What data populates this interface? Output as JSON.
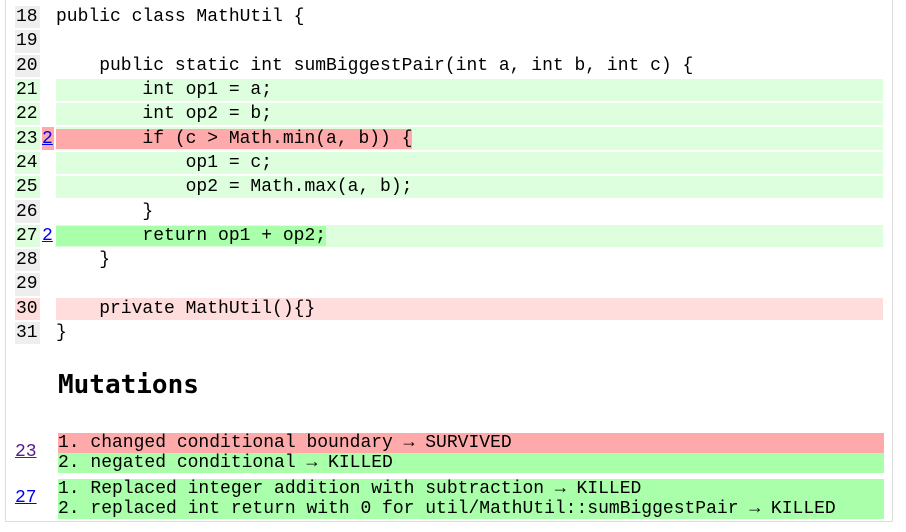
{
  "source": {
    "lines": [
      {
        "num": "18",
        "mutations": "",
        "text": "public class MathUtil {",
        "coverage": "none",
        "highlight": ""
      },
      {
        "num": "19",
        "mutations": "",
        "text": "",
        "coverage": "none",
        "highlight": ""
      },
      {
        "num": "20",
        "mutations": "",
        "text": "    public static int sumBiggestPair(int a, int b, int c) {",
        "coverage": "none",
        "highlight": ""
      },
      {
        "num": "21",
        "mutations": "",
        "text": "        int op1 = a;",
        "coverage": "covered",
        "highlight": ""
      },
      {
        "num": "22",
        "mutations": "",
        "text": "        int op2 = b;",
        "coverage": "covered",
        "highlight": ""
      },
      {
        "num": "23",
        "mutations": "2",
        "text": "        if (c > Math.min(a, b)) {",
        "coverage": "covered",
        "highlight": "survived"
      },
      {
        "num": "24",
        "mutations": "",
        "text": "            op1 = c;",
        "coverage": "covered",
        "highlight": ""
      },
      {
        "num": "25",
        "mutations": "",
        "text": "            op2 = Math.max(a, b);",
        "coverage": "covered",
        "highlight": ""
      },
      {
        "num": "26",
        "mutations": "",
        "text": "        }",
        "coverage": "none",
        "highlight": ""
      },
      {
        "num": "27",
        "mutations": "2",
        "text": "        return op1 + op2;",
        "coverage": "covered",
        "highlight": "killed"
      },
      {
        "num": "28",
        "mutations": "",
        "text": "    }",
        "coverage": "none",
        "highlight": ""
      },
      {
        "num": "29",
        "mutations": "",
        "text": "",
        "coverage": "none",
        "highlight": ""
      },
      {
        "num": "30",
        "mutations": "",
        "text": "    private MathUtil(){}",
        "coverage": "uncovered",
        "highlight": ""
      },
      {
        "num": "31",
        "mutations": "",
        "text": "}",
        "coverage": "none",
        "highlight": ""
      }
    ]
  },
  "mutations": {
    "heading": "Mutations",
    "groups": [
      {
        "line": "23",
        "visited": true,
        "items": [
          {
            "text": "1. changed conditional boundary → SURVIVED",
            "status": "SURVIVED"
          },
          {
            "text": "2. negated conditional → KILLED",
            "status": "KILLED"
          }
        ]
      },
      {
        "line": "27",
        "visited": false,
        "items": [
          {
            "text": "1. Replaced integer addition with subtraction → KILLED",
            "status": "KILLED"
          },
          {
            "text": "2. replaced int return with 0 for util/MathUtil::sumBiggestPair → KILLED",
            "status": "KILLED"
          }
        ]
      }
    ]
  },
  "colors": {
    "covered": "#ddffdd",
    "uncovered": "#ffdddd",
    "no_code": "#eeeeee",
    "survived": "#ffaaaa",
    "killed": "#aaffaa",
    "link": "#0000ee",
    "link_visited": "#551a8b"
  }
}
